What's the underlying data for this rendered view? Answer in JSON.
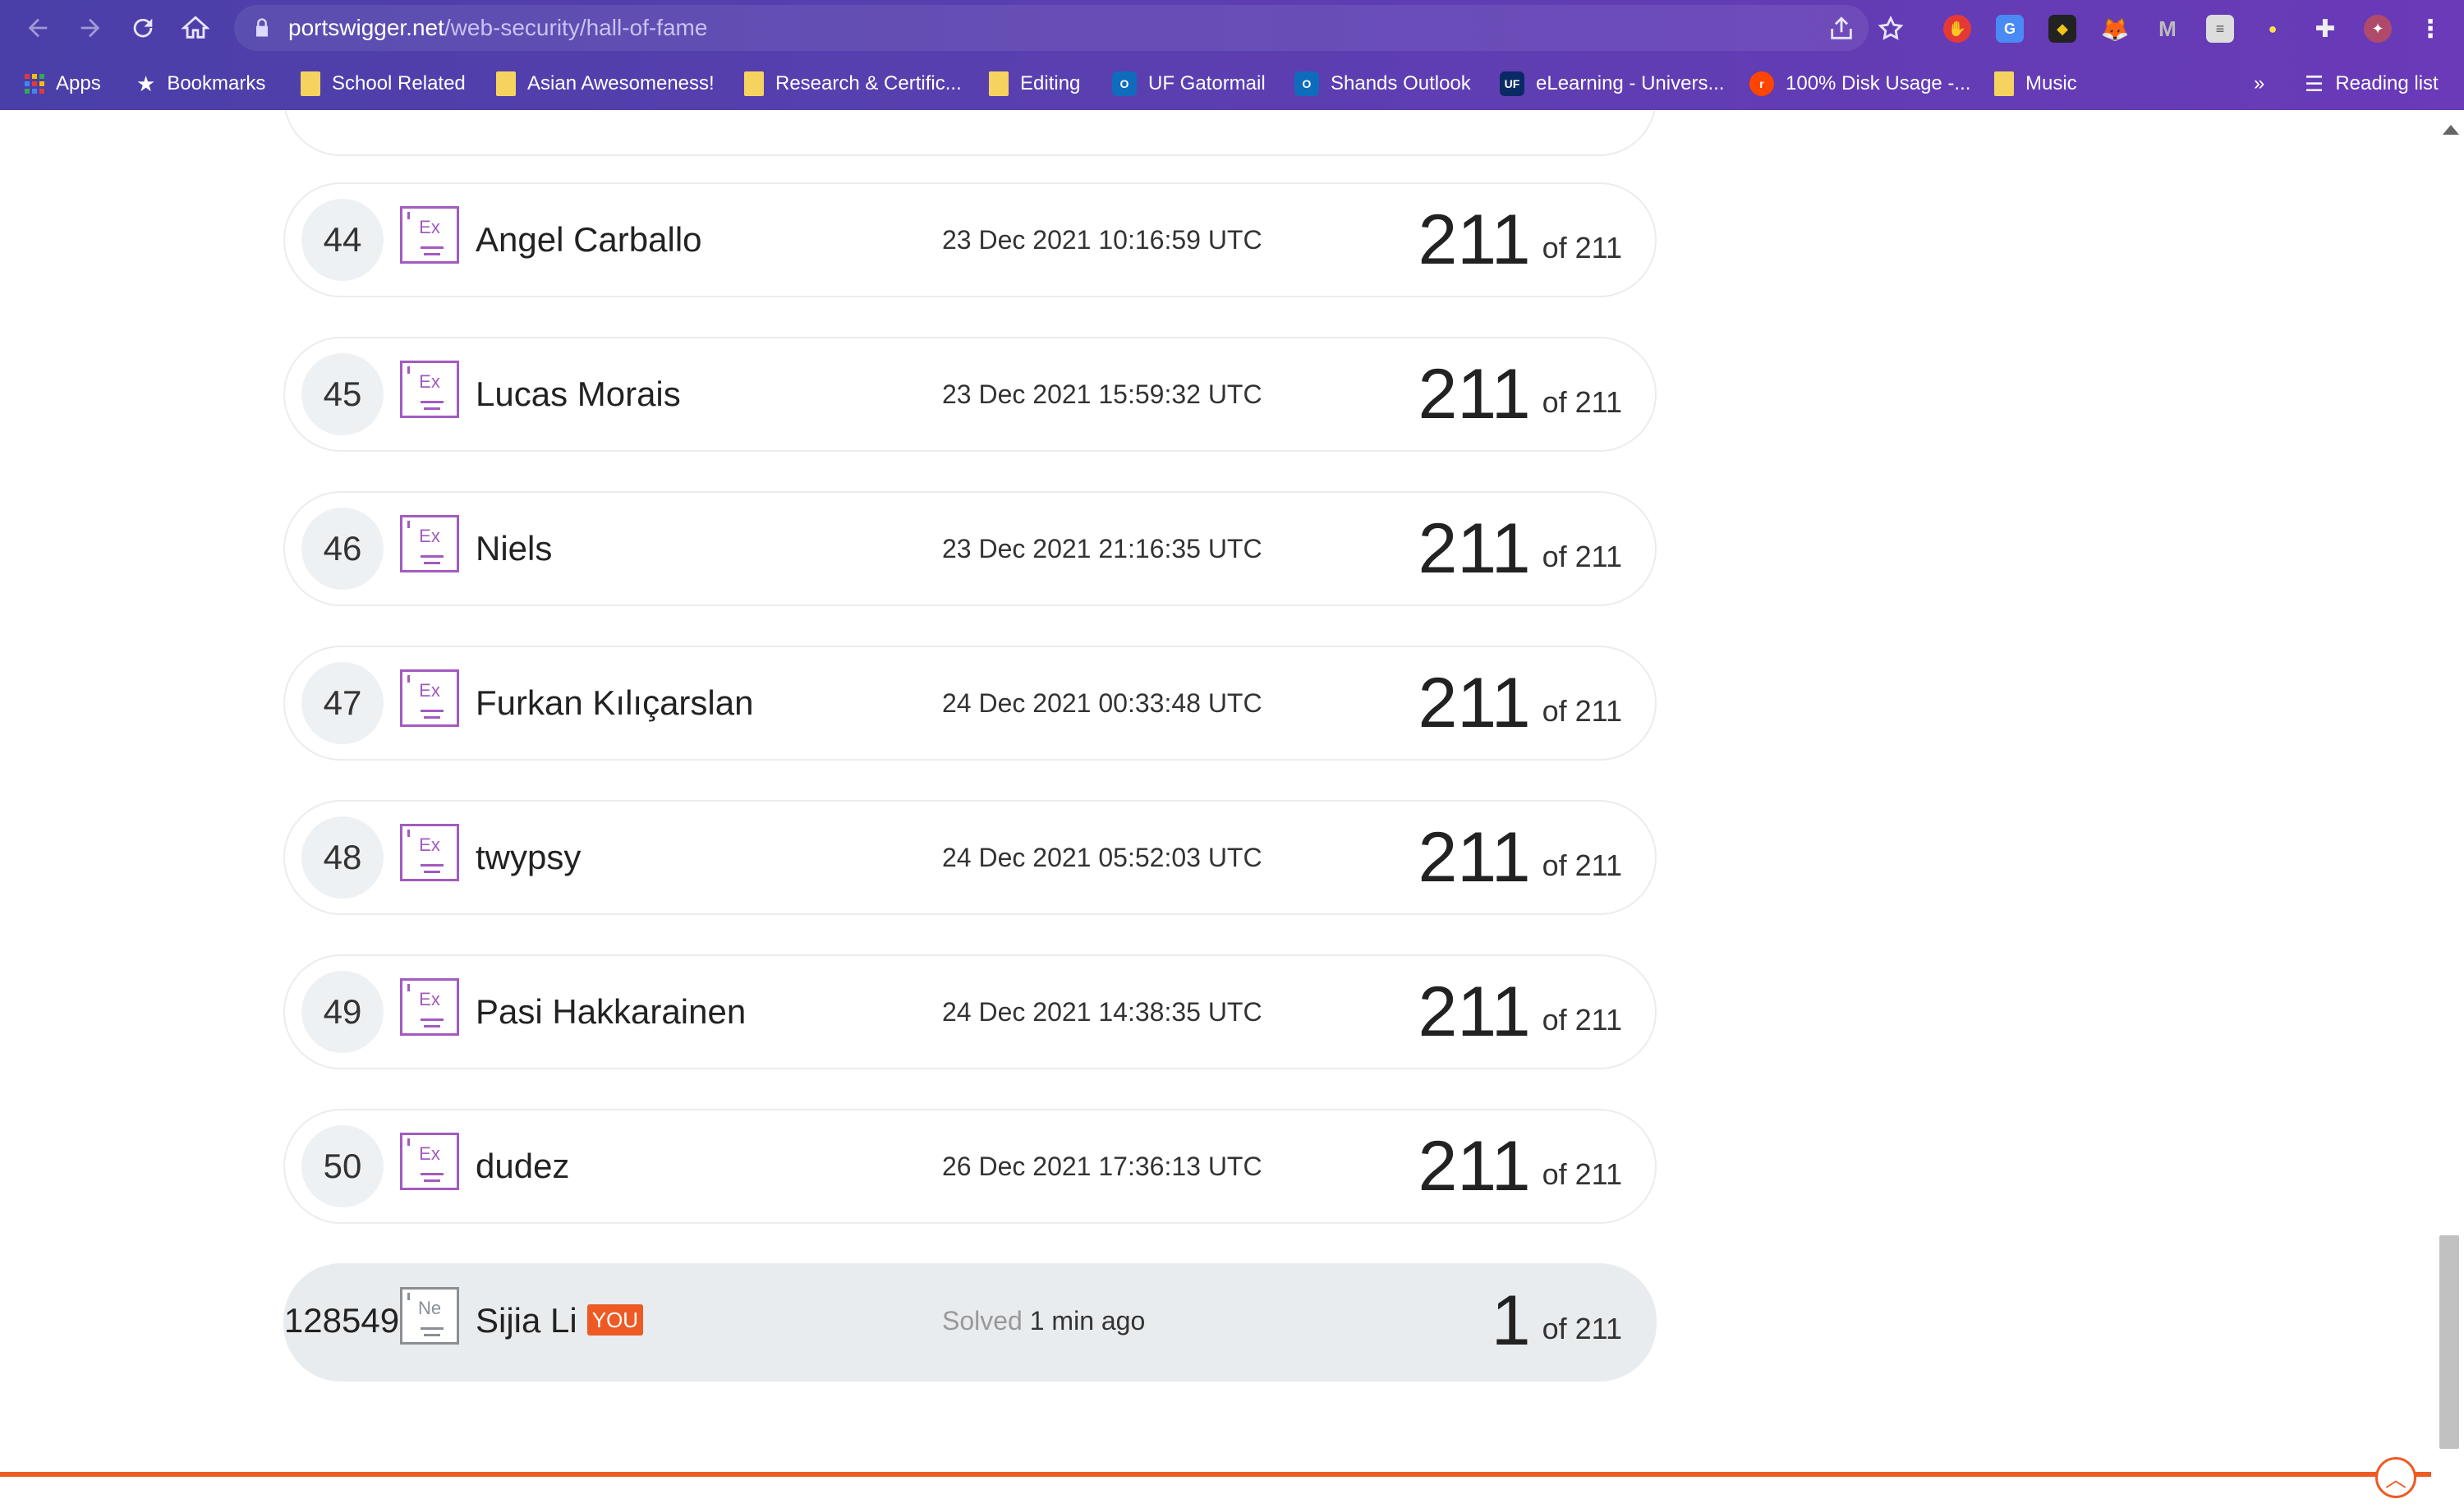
{
  "browser": {
    "url_host": "portswigger.net",
    "url_path": "/web-security/hall-of-fame",
    "reading_list": "Reading list",
    "overflow": "»",
    "bookmarks": [
      {
        "label": "Apps",
        "icon": "apps-grid-icon"
      },
      {
        "label": "Bookmarks",
        "icon": "star-icon"
      },
      {
        "label": "School Related",
        "icon": "folder-icon"
      },
      {
        "label": "Asian Awesomeness!",
        "icon": "folder-icon"
      },
      {
        "label": "Research & Certific...",
        "icon": "folder-icon"
      },
      {
        "label": "Editing",
        "icon": "folder-icon"
      },
      {
        "label": "UF Gatormail",
        "icon": "outlook-icon"
      },
      {
        "label": "Shands Outlook",
        "icon": "outlook-icon"
      },
      {
        "label": "eLearning - Univers...",
        "icon": "uf-icon"
      },
      {
        "label": "100% Disk Usage -...",
        "icon": "reddit-icon"
      },
      {
        "label": "Music",
        "icon": "folder-icon"
      }
    ]
  },
  "leaderboard": {
    "rows": [
      {
        "rank": "44",
        "badge": "Ex",
        "name": "Angel Carballo",
        "date": "23 Dec 2021 10:16:59 UTC",
        "score": "211",
        "of": "of 211"
      },
      {
        "rank": "45",
        "badge": "Ex",
        "name": "Lucas Morais",
        "date": "23 Dec 2021 15:59:32 UTC",
        "score": "211",
        "of": "of 211"
      },
      {
        "rank": "46",
        "badge": "Ex",
        "name": "Niels",
        "date": "23 Dec 2021 21:16:35 UTC",
        "score": "211",
        "of": "of 211"
      },
      {
        "rank": "47",
        "badge": "Ex",
        "name": "Furkan Kılıçarslan",
        "date": "24 Dec 2021 00:33:48 UTC",
        "score": "211",
        "of": "of 211"
      },
      {
        "rank": "48",
        "badge": "Ex",
        "name": "twypsy",
        "date": "24 Dec 2021 05:52:03 UTC",
        "score": "211",
        "of": "of 211"
      },
      {
        "rank": "49",
        "badge": "Ex",
        "name": "Pasi Hakkarainen",
        "date": "24 Dec 2021 14:38:35 UTC",
        "score": "211",
        "of": "of 211"
      },
      {
        "rank": "50",
        "badge": "Ex",
        "name": "dudez",
        "date": "26 Dec 2021 17:36:13 UTC",
        "score": "211",
        "of": "of 211"
      }
    ],
    "you": {
      "rank": "128549",
      "badge": "Ne",
      "name": "Sijia Li",
      "you_label": "YOU",
      "solved_label": "Solved",
      "solved_when": "1 min ago",
      "score": "1",
      "of": "of 211"
    }
  },
  "colors": {
    "accent": "#ee5a24",
    "expert_badge": "#a35bc0",
    "newbie_badge": "#8a8f94",
    "row_border": "#ececec"
  }
}
